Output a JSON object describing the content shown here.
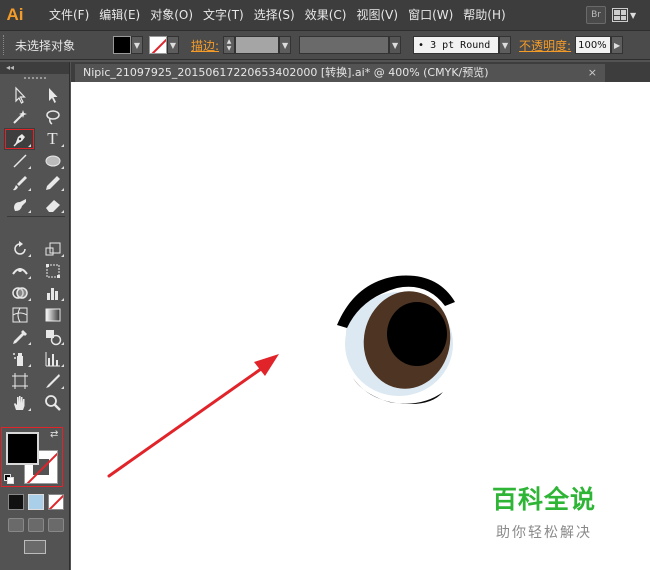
{
  "app": {
    "logo_text": "Ai"
  },
  "menu": {
    "items": [
      {
        "id": "file",
        "label": "文件(F)"
      },
      {
        "id": "edit",
        "label": "编辑(E)"
      },
      {
        "id": "object",
        "label": "对象(O)"
      },
      {
        "id": "type",
        "label": "文字(T)"
      },
      {
        "id": "select",
        "label": "选择(S)"
      },
      {
        "id": "effect",
        "label": "效果(C)"
      },
      {
        "id": "view",
        "label": "视图(V)"
      },
      {
        "id": "window",
        "label": "窗口(W)"
      },
      {
        "id": "help",
        "label": "帮助(H)"
      }
    ],
    "bridge_label": "Br"
  },
  "control": {
    "selection_label": "未选择对象",
    "stroke_label": "描边:",
    "brush_label": "3 pt Round",
    "opacity_label": "不透明度:",
    "opacity_value": "100%"
  },
  "tools_panel": {
    "collapse_glyph": "◂◂"
  },
  "document": {
    "tab_title": "Nipic_21097925_20150617220653402000  [转换].ai* @ 400% (CMYK/预览)",
    "close_glyph": "×"
  },
  "colors": {
    "accent_orange": "#f49b28",
    "highlight_red": "#e0242a",
    "iris_brown": "#4e3422",
    "sclera_blue": "#dce9f2",
    "watermark_green": "#2fb536"
  },
  "watermark": {
    "title": "百科全说",
    "subtitle": "助你轻松解决"
  }
}
